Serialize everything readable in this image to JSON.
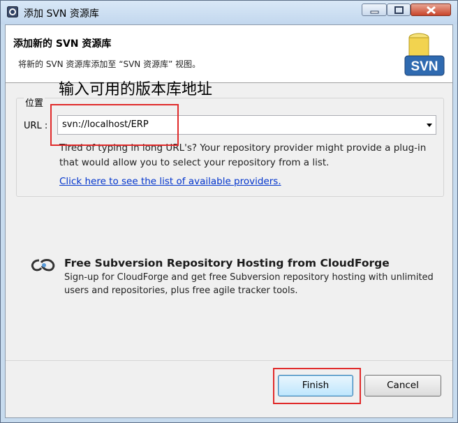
{
  "window": {
    "title": "添加 SVN 资源库",
    "controls": [
      "minimize-icon",
      "maximize-icon",
      "close-icon"
    ]
  },
  "banner": {
    "heading": "添加新的 SVN 资源库",
    "description": "将新的 SVN 资源库添加至 “SVN 资源库” 视图。",
    "logo_text": "SVN"
  },
  "annotation": {
    "text": "输入可用的版本库地址",
    "highlight_color": "#e02a2a"
  },
  "location_group": {
    "label": "位置",
    "url_label": "URL :",
    "url_value": "svn://localhost/ERP",
    "help_text": "Tired of typing in long URL's?  Your repository provider might provide a plug-in that would allow you to select your repository from a list.",
    "providers_link": "Click here to see the list of available providers."
  },
  "cloudforge": {
    "icon": "cloudforge-logo-icon",
    "title": "Free Subversion Repository Hosting from CloudForge",
    "description": "Sign-up for CloudForge and get free Subversion repository hosting with unlimited users and repositories, plus free agile tracker tools."
  },
  "buttons": {
    "finish": "Finish",
    "cancel": "Cancel"
  },
  "colors": {
    "title_bar": "#c7dbee",
    "link": "#0033cc",
    "dialog_bg": "#f0f0f0"
  }
}
